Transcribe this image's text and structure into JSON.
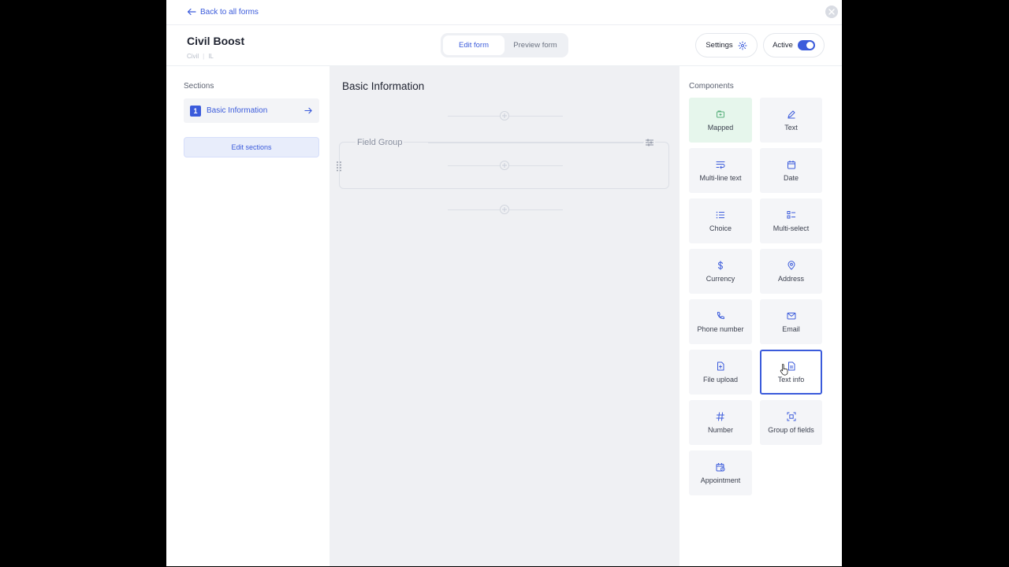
{
  "header": {
    "back_label": "Back to all forms",
    "form_title": "Civil Boost",
    "form_meta": [
      "Civil",
      "IL"
    ],
    "modes": [
      {
        "label": "Edit form",
        "active": true
      },
      {
        "label": "Preview form",
        "active": false
      }
    ],
    "settings_label": "Settings",
    "active_label": "Active",
    "active_on": true
  },
  "sections": {
    "label": "Sections",
    "items": [
      {
        "number": "1",
        "name": "Basic Information"
      }
    ],
    "edit_label": "Edit sections"
  },
  "canvas": {
    "section_title": "Basic Information",
    "field_group_title": "Field Group"
  },
  "components": {
    "label": "Components",
    "items": [
      {
        "label": "Mapped",
        "icon": "mapped-icon"
      },
      {
        "label": "Text",
        "icon": "pencil-icon"
      },
      {
        "label": "Multi-line text",
        "icon": "multiline-icon"
      },
      {
        "label": "Date",
        "icon": "calendar-icon"
      },
      {
        "label": "Choice",
        "icon": "list-icon"
      },
      {
        "label": "Multi-select",
        "icon": "checklist-icon"
      },
      {
        "label": "Currency",
        "icon": "dollar-icon"
      },
      {
        "label": "Address",
        "icon": "location-pin-icon"
      },
      {
        "label": "Phone number",
        "icon": "phone-icon"
      },
      {
        "label": "Email",
        "icon": "envelope-icon"
      },
      {
        "label": "File upload",
        "icon": "file-upload-icon"
      },
      {
        "label": "Text info",
        "icon": "document-icon"
      },
      {
        "label": "Number",
        "icon": "hash-icon"
      },
      {
        "label": "Group of fields",
        "icon": "group-icon"
      },
      {
        "label": "Appointment",
        "icon": "calendar-clock-icon"
      }
    ],
    "selected": "Text info"
  },
  "colors": {
    "accent": "#3b5bdb",
    "canvas_bg": "#eff0f3",
    "card_bg": "#f4f5f8",
    "mapped_bg": "#e6f6ec"
  }
}
